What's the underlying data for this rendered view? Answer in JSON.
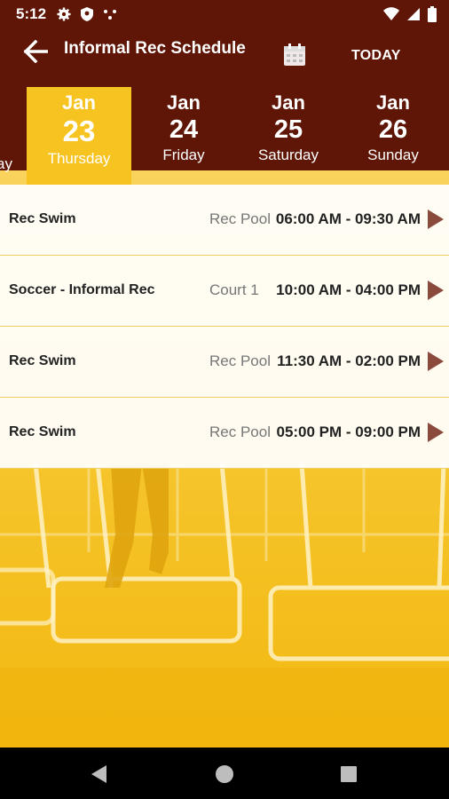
{
  "status": {
    "time": "5:12"
  },
  "app_bar": {
    "title": "Informal Rec Schedule",
    "today_label": "TODAY"
  },
  "days": [
    {
      "month": "",
      "day": "",
      "weekday": "ay"
    },
    {
      "month": "Jan",
      "day": "23",
      "weekday": "Thursday",
      "selected": true
    },
    {
      "month": "Jan",
      "day": "24",
      "weekday": "Friday"
    },
    {
      "month": "Jan",
      "day": "25",
      "weekday": "Saturday"
    },
    {
      "month": "Jan",
      "day": "26",
      "weekday": "Sunday"
    }
  ],
  "schedule": [
    {
      "name": "Rec Swim",
      "location": "Rec Pool",
      "time": "06:00 AM - 09:30 AM"
    },
    {
      "name": "Soccer - Informal Rec",
      "location": "Court 1",
      "time": "10:00 AM - 04:00 PM"
    },
    {
      "name": "Rec Swim",
      "location": "Rec Pool",
      "time": "11:30 AM - 02:00 PM"
    },
    {
      "name": "Rec Swim",
      "location": "Rec Pool",
      "time": "05:00 PM - 09:00 PM"
    }
  ],
  "colors": {
    "header": "#5f1606",
    "accent": "#f6c320",
    "arrow": "#8a4a3c"
  },
  "icons": {
    "status_left": [
      "settings-icon",
      "shield-icon",
      "network-dots-icon"
    ],
    "status_right": [
      "wifi-icon",
      "signal-icon",
      "battery-icon"
    ],
    "nav": [
      "back-triangle-icon",
      "home-circle-icon",
      "recents-square-icon"
    ]
  }
}
